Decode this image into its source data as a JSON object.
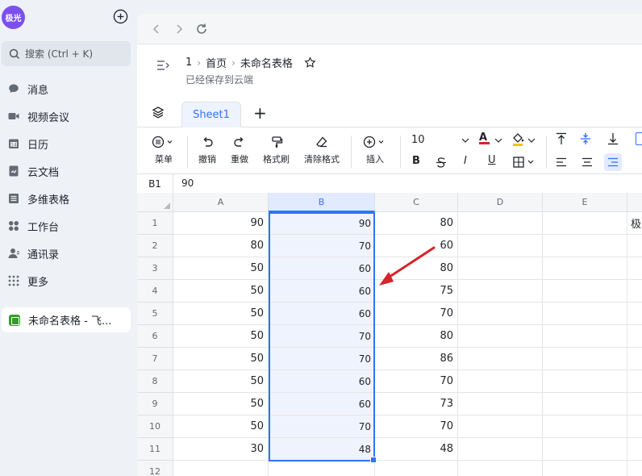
{
  "sidebar": {
    "avatar_text": "极光",
    "search_placeholder": "搜索 (Ctrl + K)",
    "nav": [
      {
        "label": "消息",
        "icon": "chat-icon"
      },
      {
        "label": "视频会议",
        "icon": "video-icon"
      },
      {
        "label": "日历",
        "icon": "calendar-icon"
      },
      {
        "label": "云文档",
        "icon": "cloud-doc-icon"
      },
      {
        "label": "多维表格",
        "icon": "base-table-icon"
      },
      {
        "label": "工作台",
        "icon": "workplace-icon"
      },
      {
        "label": "通讯录",
        "icon": "contacts-icon"
      },
      {
        "label": "更多",
        "icon": "more-grid-icon"
      }
    ],
    "open_doc": "未命名表格 - 飞..."
  },
  "header": {
    "crumb_1": "1",
    "crumb_home": "首页",
    "title": "未命名表格",
    "saved": "已经保存到云端"
  },
  "tabs": {
    "sheet": "Sheet1",
    "add": "+"
  },
  "toolbar": {
    "menu": "菜单",
    "undo": "撤销",
    "redo": "重做",
    "painter": "格式刷",
    "clear": "清除格式",
    "insert": "插入",
    "font_size": "10",
    "bold": "B",
    "italic": "I",
    "underline": "U",
    "font_color_letter": "A"
  },
  "formula": {
    "cell_ref": "B1",
    "value": "90"
  },
  "grid": {
    "columns": [
      "A",
      "B",
      "C",
      "D",
      "E"
    ],
    "rows": [
      "1",
      "2",
      "3",
      "4",
      "5",
      "6",
      "7",
      "8",
      "9",
      "10",
      "11",
      "12"
    ],
    "col_a": [
      "90",
      "80",
      "50",
      "50",
      "50",
      "50",
      "50",
      "50",
      "50",
      "50",
      "30",
      ""
    ],
    "col_b": [
      "90",
      "70",
      "60",
      "60",
      "60",
      "70",
      "70",
      "60",
      "60",
      "70",
      "48",
      ""
    ],
    "col_c": [
      "80",
      "60",
      "80",
      "75",
      "70",
      "80",
      "86",
      "70",
      "73",
      "70",
      "48",
      ""
    ],
    "e1_partial": "极"
  },
  "colors": {
    "accent": "#3370ff",
    "arrow": "#d8232a",
    "avatar": "#7b4ff0"
  }
}
